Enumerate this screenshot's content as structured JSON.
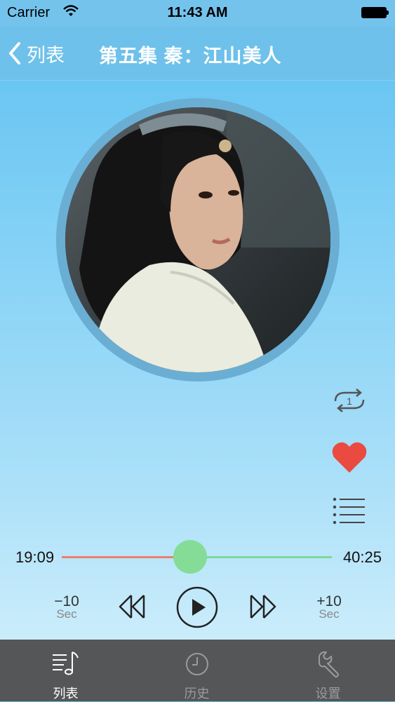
{
  "status_bar": {
    "carrier": "Carrier",
    "time": "11:43 AM"
  },
  "nav": {
    "back_label": "列表",
    "title": "第五集 秦：江山美人"
  },
  "player": {
    "cover_icon": "album-cover-portrait",
    "current_time": "19:09",
    "total_time": "40:25",
    "progress": 0.473,
    "rewind_label": "−10",
    "rewind_unit": "Sec",
    "forward_label": "+10",
    "forward_unit": "Sec",
    "side_buttons": [
      "repeat-one-icon",
      "heart-icon",
      "playlist-icon"
    ]
  },
  "tabs": [
    {
      "label": "列表",
      "icon": "music-list-icon",
      "active": true
    },
    {
      "label": "历史",
      "icon": "clock-icon",
      "active": false
    },
    {
      "label": "设置",
      "icon": "wrench-icon",
      "active": false
    }
  ],
  "colors": {
    "accent_played": "#ef7f6b",
    "accent_remaining": "#7ed99a",
    "heart": "#ea4a3f",
    "tabbar": "#555657",
    "tab_active": "#ffffff",
    "tab_inactive": "#9a9b9c"
  }
}
